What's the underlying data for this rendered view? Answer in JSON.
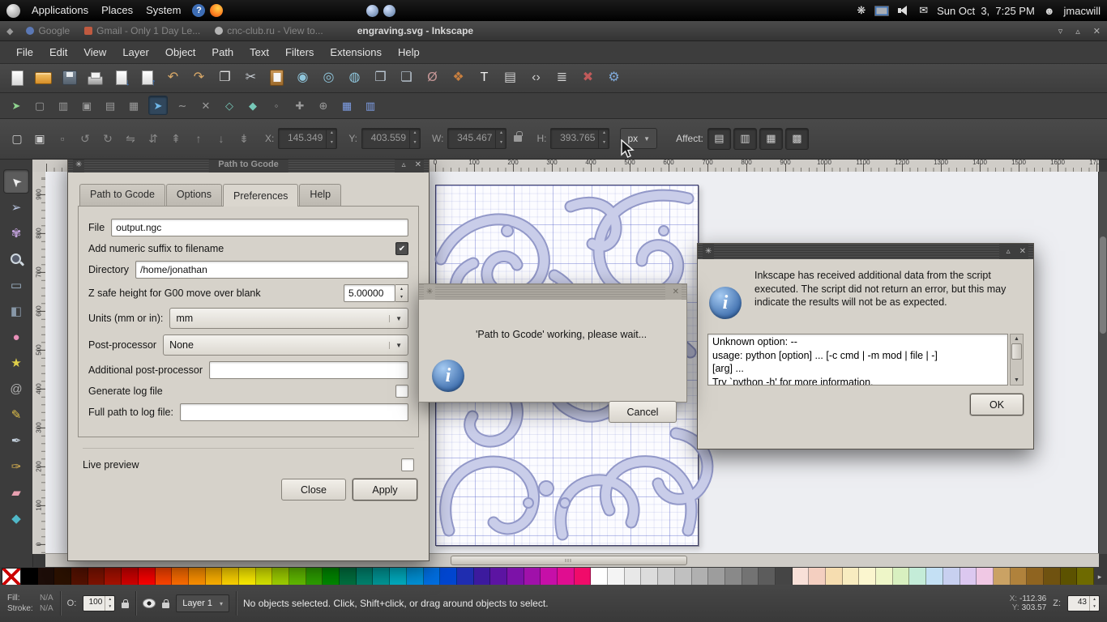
{
  "panel": {
    "menus": [
      "Applications",
      "Places",
      "System"
    ],
    "clock": "Sun Oct  3,  7:25 PM",
    "user": "jmacwill"
  },
  "titlebar": {
    "background_windows": [
      "Google",
      "Gmail - Only 1 Day Le...",
      "cnc-club.ru - View to..."
    ],
    "title": "engraving.svg - Inkscape"
  },
  "menubar": [
    "File",
    "Edit",
    "View",
    "Layer",
    "Object",
    "Path",
    "Text",
    "Filters",
    "Extensions",
    "Help"
  ],
  "commandbar": [
    {
      "name": "new-document-icon",
      "cls": "c-page"
    },
    {
      "name": "open-document-icon",
      "cls": "c-folder"
    },
    {
      "name": "save-document-icon",
      "cls": "c-disk"
    },
    {
      "name": "print-icon",
      "cls": "c-printer"
    },
    {
      "name": "import-icon",
      "cls": "c-import"
    },
    {
      "name": "export-icon",
      "cls": "c-export"
    },
    {
      "name": "undo-icon",
      "glyph": "↶",
      "color": "#d8a868"
    },
    {
      "name": "redo-icon",
      "glyph": "↷",
      "color": "#d8a868"
    },
    {
      "name": "copy-icon",
      "glyph": "❐",
      "color": "#e0e0e0"
    },
    {
      "name": "cut-icon",
      "glyph": "✂",
      "color": "#c8ced4"
    },
    {
      "name": "paste-icon",
      "cls": "c-clipboard"
    },
    {
      "name": "zoom-selection-icon",
      "glyph": "◉",
      "color": "#8fc6dc"
    },
    {
      "name": "zoom-drawing-icon",
      "glyph": "◎",
      "color": "#8fc6dc"
    },
    {
      "name": "zoom-page-icon",
      "glyph": "◍",
      "color": "#8fc6dc"
    },
    {
      "name": "duplicate-icon",
      "glyph": "❐",
      "color": "#bcc8d4"
    },
    {
      "name": "clone-icon",
      "glyph": "❏",
      "color": "#bcc8d4"
    },
    {
      "name": "unlink-clone-icon",
      "glyph": "Ø",
      "color": "#c89898"
    },
    {
      "name": "fill-stroke-icon",
      "glyph": "❖",
      "color": "#c87f3f"
    },
    {
      "name": "text-dialog-icon",
      "glyph": "T",
      "color": "#f0f0f0"
    },
    {
      "name": "layers-dialog-icon",
      "glyph": "▤",
      "color": "#cfcfcf"
    },
    {
      "name": "xml-editor-icon",
      "glyph": "‹›",
      "color": "#cfcfcf"
    },
    {
      "name": "align-dialog-icon",
      "glyph": "≣",
      "color": "#cfcfcf"
    },
    {
      "name": "preferences-icon",
      "glyph": "✖",
      "color": "#c05a5a"
    },
    {
      "name": "document-properties-icon",
      "glyph": "⚙",
      "color": "#7fa8d8"
    }
  ],
  "snapbar": [
    {
      "name": "snap-enable-icon",
      "glyph": "➤",
      "color": "#8fd48f"
    },
    {
      "name": "snap-bbox-icon",
      "glyph": "▢",
      "color": "#9a9a9a"
    },
    {
      "name": "snap-bbox-edge-icon",
      "glyph": "▥",
      "color": "#9a9a9a"
    },
    {
      "name": "snap-bbox-corner-icon",
      "glyph": "▣",
      "color": "#9a9a9a"
    },
    {
      "name": "snap-bbox-midpoint-icon",
      "glyph": "▤",
      "color": "#9a9a9a"
    },
    {
      "name": "snap-bbox-center-icon",
      "glyph": "▦",
      "color": "#9a9a9a"
    },
    {
      "name": "snap-nodes-icon",
      "glyph": "➤",
      "color": "#6fb7e8",
      "cls": "pressed"
    },
    {
      "name": "snap-path-icon",
      "glyph": "∼",
      "color": "#9a9a9a"
    },
    {
      "name": "snap-path-intersection-icon",
      "glyph": "✕",
      "color": "#9a9a9a"
    },
    {
      "name": "snap-node-cusp-icon",
      "glyph": "◇",
      "color": "#76c8b8"
    },
    {
      "name": "snap-node-smooth-icon",
      "glyph": "◆",
      "color": "#76c8b8"
    },
    {
      "name": "snap-midpoint-icon",
      "glyph": "◦",
      "color": "#9a9a9a"
    },
    {
      "name": "snap-others-icon",
      "glyph": "✚",
      "color": "#9a9a9a"
    },
    {
      "name": "snap-rotation-center-icon",
      "glyph": "⊕",
      "color": "#9a9a9a"
    },
    {
      "name": "snap-grid-icon",
      "glyph": "▦",
      "color": "#7f9fe8"
    },
    {
      "name": "snap-guide-icon",
      "glyph": "▥",
      "color": "#7f9fe8"
    }
  ],
  "controls": {
    "icons": [
      {
        "name": "select-all-icon",
        "glyph": "▢",
        "color": "#cfcfcf"
      },
      {
        "name": "select-all-layers-icon",
        "glyph": "▣",
        "color": "#cfcfcf"
      },
      {
        "name": "deselect-icon",
        "glyph": "▫",
        "color": "#8a8a8a"
      },
      {
        "name": "rotate-ccw-icon",
        "glyph": "↺",
        "color": "#8a8a8a"
      },
      {
        "name": "rotate-cw-icon",
        "glyph": "↻",
        "color": "#8a8a8a"
      },
      {
        "name": "flip-horizontal-icon",
        "glyph": "⇋",
        "color": "#8a8a8a"
      },
      {
        "name": "flip-vertical-icon",
        "glyph": "⇵",
        "color": "#8a8a8a"
      },
      {
        "name": "raise-to-top-icon",
        "glyph": "⇞",
        "color": "#8a8a8a"
      },
      {
        "name": "raise-icon",
        "glyph": "↑",
        "color": "#8a8a8a"
      },
      {
        "name": "lower-icon",
        "glyph": "↓",
        "color": "#8a8a8a"
      },
      {
        "name": "lower-to-bottom-icon",
        "glyph": "⇟",
        "color": "#8a8a8a"
      }
    ],
    "x_label": "X:",
    "x": "145.349",
    "y_label": "Y:",
    "y": "403.559",
    "w_label": "W:",
    "w": "345.467",
    "h_label": "H:",
    "h": "393.765",
    "units": "px",
    "affect_label": "Affect:",
    "affect_icons": [
      {
        "name": "affect-stroke-icon",
        "glyph": "▤"
      },
      {
        "name": "affect-corners-icon",
        "glyph": "▥"
      },
      {
        "name": "affect-gradients-icon",
        "glyph": "▦"
      },
      {
        "name": "affect-patterns-icon",
        "glyph": "▩"
      }
    ]
  },
  "toolbox": [
    {
      "name": "selector-tool",
      "glyph": "➤",
      "color": "#ececec",
      "cls": "active t-sel"
    },
    {
      "name": "node-tool",
      "glyph": "➢",
      "color": "#b8c4e0"
    },
    {
      "name": "tweak-tool",
      "glyph": "✾",
      "color": "#bf9fd8"
    },
    {
      "name": "zoom-tool",
      "cls": "t-zoom"
    },
    {
      "name": "rectangle-tool",
      "glyph": "▭",
      "color": "#9fb4c8"
    },
    {
      "name": "box3d-tool",
      "glyph": "◧",
      "color": "#8898a8"
    },
    {
      "name": "ellipse-tool",
      "glyph": "●",
      "color": "#e890b8"
    },
    {
      "name": "star-tool",
      "glyph": "★",
      "color": "#e0d04a"
    },
    {
      "name": "spiral-tool",
      "glyph": "@",
      "color": "#b0b0b0"
    },
    {
      "name": "pencil-tool",
      "glyph": "✎",
      "color": "#e0c04a"
    },
    {
      "name": "pen-tool",
      "glyph": "✒",
      "color": "#c0ccd8"
    },
    {
      "name": "calligraphy-tool",
      "glyph": "✑",
      "color": "#d8b050"
    },
    {
      "name": "eraser-tool",
      "glyph": "▰",
      "color": "#e8a0b0"
    },
    {
      "name": "paint-bucket-tool",
      "glyph": "◆",
      "color": "#50b8c8"
    }
  ],
  "rulers": {
    "h": [
      "0",
      "100",
      "200",
      "300",
      "400",
      "500",
      "600",
      "700",
      "800",
      "900",
      "1000",
      "1100",
      "1200",
      "1300",
      "1400",
      "1500",
      "1600",
      "1700"
    ],
    "v": [
      "900",
      "800",
      "700",
      "600",
      "500",
      "400",
      "300",
      "200",
      "100",
      "0"
    ]
  },
  "gcode": {
    "title": "Path to Gcode",
    "tabs": [
      {
        "label": "Path to Gcode"
      },
      {
        "label": "Options"
      },
      {
        "label": "Preferences",
        "cls": "active"
      },
      {
        "label": "Help"
      }
    ],
    "file_label": "File",
    "file_value": "output.ngc",
    "suffix_label": "Add numeric suffix to filename",
    "suffix_checked": true,
    "dir_label": "Directory",
    "dir_value": "/home/jonathan",
    "zsafe_label": "Z safe height for G00 move over blank",
    "zsafe_value": "5.00000",
    "units_label": "Units (mm or in):",
    "units_value": "mm",
    "postproc_label": "Post-processor",
    "postproc_value": "None",
    "addpostproc_label": "Additional post-processor",
    "addpostproc_value": "",
    "genlog_label": "Generate log file",
    "logpath_label": "Full path to log file:",
    "logpath_value": "",
    "live_preview_label": "Live preview",
    "close_label": "Close",
    "apply_label": "Apply"
  },
  "working": {
    "message": "'Path to Gcode' working, please wait...",
    "cancel_label": "Cancel"
  },
  "script": {
    "message": "Inkscape has received additional data from the script executed.  The script did not return an error, but this may indicate the results will not be as expected.",
    "output_lines": [
      "Unknown option: --",
      "usage: python [option] ... [-c cmd | -m mod | file | -]",
      "[arg] ...",
      "Try `python -h' for more information."
    ],
    "ok_label": "OK"
  },
  "palette": [
    "#000000",
    "#1c0d08",
    "#2b1100",
    "#551100",
    "#801300",
    "#aa1100",
    "#d40000",
    "#ff0000",
    "#ff4500",
    "#ff6e00",
    "#ff9200",
    "#ffb300",
    "#ffd500",
    "#fff000",
    "#d7e600",
    "#a0d200",
    "#62bc00",
    "#2da000",
    "#008a00",
    "#007140",
    "#00836f",
    "#009797",
    "#00aec2",
    "#0092d8",
    "#006ee0",
    "#0046d0",
    "#1f2db0",
    "#3c1a9e",
    "#5c14a2",
    "#7c12a8",
    "#a011aa",
    "#c60fa8",
    "#e00d90",
    "#f00b6a",
    "#ffffff",
    "#f4f4f4",
    "#e8e8e8",
    "#dcdcdc",
    "#cfcfcf",
    "#c0c0c0",
    "#b0b0b0",
    "#9d9d9d",
    "#898989",
    "#737373",
    "#5c5c5c",
    "#454545",
    "#f8e0d8",
    "#f4cfc0",
    "#f6ddb0",
    "#f8ecc0",
    "#fbf6cf",
    "#eef6c8",
    "#d8f0c0",
    "#c4ecd8",
    "#c4e0f4",
    "#c8d0f0",
    "#dcc8f0",
    "#f0c8e4",
    "#caa264",
    "#b0823c",
    "#8f6420",
    "#6f5210",
    "#5c5200",
    "#6e6a00"
  ],
  "status": {
    "fill_label": "Fill:",
    "fill_value": "N/A",
    "stroke_label": "Stroke:",
    "stroke_value": "N/A",
    "opacity_label": "O:",
    "opacity_value": "100",
    "layer_label": "Layer 1",
    "message": "No objects selected. Click, Shift+click, or drag around objects to select.",
    "x_label": "X:",
    "x_value": "-112.36",
    "y_label": "Y:",
    "y_value": "303.57",
    "z_label": "Z:",
    "zoom_value": "43"
  }
}
